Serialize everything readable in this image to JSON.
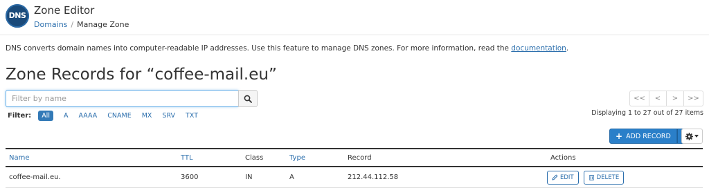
{
  "header": {
    "logo_text": "DNS",
    "app_title": "Zone Editor",
    "breadcrumb": {
      "root": "Domains",
      "separator": "/",
      "current": "Manage Zone"
    }
  },
  "description": {
    "text": "DNS converts domain names into computer-readable IP addresses. Use this feature to manage DNS zones. For more information, read the ",
    "link": "documentation",
    "suffix": "."
  },
  "page_title": "Zone Records for “coffee-mail.eu”",
  "search": {
    "placeholder": "Filter by name",
    "value": ""
  },
  "filter": {
    "label": "Filter:",
    "options": [
      "All",
      "A",
      "AAAA",
      "CNAME",
      "MX",
      "SRV",
      "TXT"
    ],
    "selected": "All"
  },
  "pagination": {
    "first": "<<",
    "prev": "<",
    "next": ">",
    "last": ">>",
    "summary": "Displaying 1 to 27 out of 27 items"
  },
  "toolbar": {
    "add_record_label": "ADD RECORD"
  },
  "table": {
    "headers": {
      "name": "Name",
      "ttl": "TTL",
      "class": "Class",
      "type": "Type",
      "record": "Record",
      "actions": "Actions"
    },
    "rows": [
      {
        "name": "coffee-mail.eu.",
        "ttl": "3600",
        "class": "IN",
        "type": "A",
        "record": "212.44.112.58",
        "edit": "EDIT",
        "delete": "DELETE"
      }
    ]
  },
  "colors": {
    "accent": "#2c6fad",
    "primary_button": "#2a7fc9",
    "active_filter": "#337ab7"
  }
}
